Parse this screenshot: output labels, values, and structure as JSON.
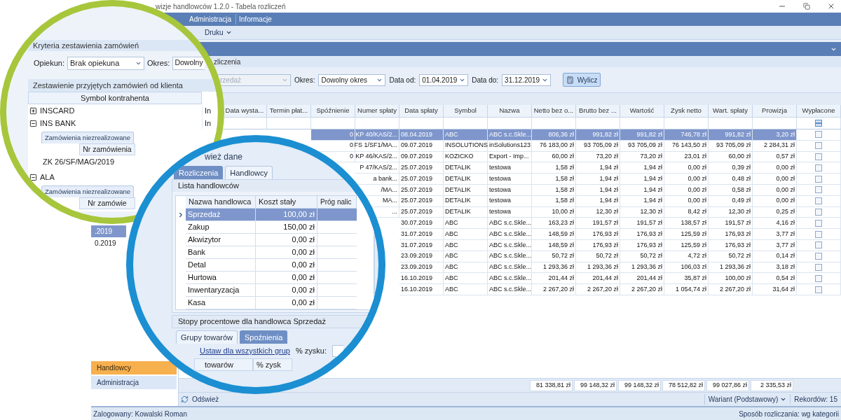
{
  "window": {
    "title": "wizje handlowców 1.2.0 - Tabela rozliczeń"
  },
  "menu": [
    {
      "label": "Administracja"
    },
    {
      "label": "Informacje"
    }
  ],
  "toolbar": {
    "print_menu": "Druku"
  },
  "settlement_panel": {
    "title": "zliczenia",
    "salesperson": {
      "value": "rzedaż",
      "disabled": true
    },
    "period_label": "Okres:",
    "period": "Dowolny okres",
    "date_from_label": "Data od:",
    "date_from": "01.04.2019",
    "date_to_label": "Data do:",
    "date_to": "31.12.2019",
    "calculate_button": "Wylicz"
  },
  "table": {
    "columns": [
      "Data wysta...",
      "Termin płat...",
      "Spóźnienie",
      "Numer spłaty",
      "Data spłaty",
      "Symbol",
      "Nazwa",
      "Netto bez o...",
      "Brutto bez ...",
      "Wartość",
      "Zysk netto",
      "Wart. spłaty",
      "Prowizja",
      "Wypłacone"
    ],
    "rows": [
      {
        "late": "0",
        "number": "KP 40/KAS/2...",
        "payment_date": "08.04.2019",
        "symbol": "ABC",
        "name": "ABC s.c.Skle...",
        "net": "806,36 zł",
        "gross": "991,82 zł",
        "value": "991,82 zł",
        "profit": "746,78 zł",
        "payment_value": "991,82 zł",
        "commission": "3,20 zł",
        "paid": false,
        "selected": true
      },
      {
        "late": "0",
        "number": "FS 1/SF1/MA...",
        "payment_date": "09.07.2019",
        "symbol": "INSOLUTIONS",
        "name": "inSolutions123",
        "net": "76 183,00 zł",
        "gross": "93 705,09 zł",
        "value": "93 705,09 zł",
        "profit": "76 143,50 zł",
        "payment_value": "93 705,09 zł",
        "commission": "2 284,31 zł",
        "paid": false,
        "selected": false
      },
      {
        "late": "0",
        "number": "KP 46/KAS/2...",
        "payment_date": "09.07.2019",
        "symbol": "KOZICKO",
        "name": "Export - Imp...",
        "net": "60,00 zł",
        "gross": "73,20 zł",
        "value": "73,20 zł",
        "profit": "23,01 zł",
        "payment_value": "60,00 zł",
        "commission": "0,57 zł",
        "paid": false,
        "selected": false
      },
      {
        "number": "P 47/KAS/2...",
        "payment_date": "25.07.2019",
        "symbol": "DETALIK",
        "name": "testowa",
        "net": "1,58 zł",
        "gross": "1,94 zł",
        "value": "1,94 zł",
        "profit": "0,00 zł",
        "payment_value": "0,39 zł",
        "commission": "0,00 zł",
        "paid": false,
        "selected": false
      },
      {
        "number": "a bank...",
        "payment_date": "25.07.2019",
        "symbol": "DETALIK",
        "name": "testowa",
        "net": "1,58 zł",
        "gross": "1,94 zł",
        "value": "1,94 zł",
        "profit": "0,00 zł",
        "payment_value": "0,48 zł",
        "commission": "0,00 zł",
        "paid": false,
        "selected": false
      },
      {
        "number": "/MA...",
        "payment_date": "25.07.2019",
        "symbol": "DETALIK",
        "name": "testowa",
        "net": "1,58 zł",
        "gross": "1,94 zł",
        "value": "1,94 zł",
        "profit": "0,00 zł",
        "payment_value": "0,58 zł",
        "commission": "0,00 zł",
        "paid": false,
        "selected": false
      },
      {
        "number": "MA...",
        "payment_date": "25.07.2019",
        "symbol": "DETALIK",
        "name": "testowa",
        "net": "1,58 zł",
        "gross": "1,94 zł",
        "value": "1,94 zł",
        "profit": "0,00 zł",
        "payment_value": "0,49 zł",
        "commission": "0,00 zł",
        "paid": false,
        "selected": false
      },
      {
        "number": "...",
        "payment_date": "25.07.2019",
        "symbol": "DETALIK",
        "name": "testowa",
        "net": "10,00 zł",
        "gross": "12,30 zł",
        "value": "12,30 zł",
        "profit": "8,42 zł",
        "payment_value": "12,30 zł",
        "commission": "0,25 zł",
        "paid": false,
        "selected": false
      },
      {
        "payment_date": "30.07.2019",
        "symbol": "ABC",
        "name": "ABC s.c.Skle...",
        "net": "163,23 zł",
        "gross": "191,57 zł",
        "value": "191,57 zł",
        "profit": "138,57 zł",
        "payment_value": "191,57 zł",
        "commission": "4,16 zł",
        "paid": false,
        "selected": false
      },
      {
        "payment_date": "31.07.2019",
        "symbol": "ABC",
        "name": "ABC s.c.Skle...",
        "net": "148,59 zł",
        "gross": "176,93 zł",
        "value": "176,93 zł",
        "profit": "125,59 zł",
        "payment_value": "176,93 zł",
        "commission": "3,77 zł",
        "paid": false,
        "selected": false
      },
      {
        "payment_date": "31.07.2019",
        "symbol": "ABC",
        "name": "ABC s.c.Skle...",
        "net": "148,59 zł",
        "gross": "176,93 zł",
        "value": "176,93 zł",
        "profit": "125,59 zł",
        "payment_value": "176,93 zł",
        "commission": "3,77 zł",
        "paid": false,
        "selected": false
      },
      {
        "payment_date": "23.09.2019",
        "symbol": "ABC",
        "name": "ABC s.c.Skle...",
        "net": "50,72 zł",
        "gross": "50,72 zł",
        "value": "50,72 zł",
        "profit": "4,72 zł",
        "payment_value": "50,72 zł",
        "commission": "0,14 zł",
        "paid": false,
        "selected": false
      },
      {
        "payment_date": "23.09.2019",
        "symbol": "ABC",
        "name": "ABC s.c.Skle...",
        "net": "1 293,36 zł",
        "gross": "1 293,36 zł",
        "value": "1 293,36 zł",
        "profit": "106,03 zł",
        "payment_value": "1 293,36 zł",
        "commission": "3,18 zł",
        "paid": false,
        "selected": false
      },
      {
        "payment_date": "16.10.2019",
        "symbol": "ABC",
        "name": "ABC s.c.Skle...",
        "net": "201,44 zł",
        "gross": "201,44 zł",
        "value": "201,44 zł",
        "profit": "35,87 zł",
        "payment_value": "100,00 zł",
        "commission": "0,54 zł",
        "paid": false,
        "selected": false
      },
      {
        "payment_date": "16.10.2019",
        "symbol": "ABC",
        "name": "ABC s.c.Skle...",
        "net": "2 267,20 zł",
        "gross": "2 267,20 zł",
        "value": "2 267,20 zł",
        "profit": "1 054,74 zł",
        "payment_value": "2 267,20 zł",
        "commission": "31,64 zł",
        "paid": false,
        "selected": false
      }
    ],
    "totals": [
      "81 338,81 zł",
      "99 148,32 zł",
      "99 148,32 zł",
      "78 512,82 zł",
      "99 027,86 zł",
      "2 335,53 zł"
    ]
  },
  "left_panel": {
    "dates": [
      {
        "text": ".2019",
        "selected": true
      },
      {
        "text": "0.2019",
        "selected": false
      }
    ],
    "nav": [
      {
        "label": "Handlowcy",
        "selected": true
      },
      {
        "label": "Administracja",
        "selected": false
      }
    ]
  },
  "bottom_bar": {
    "refresh_button": "Odśwież",
    "variant": "Wariant (Podstawowy)",
    "records": "Rekordów: 15"
  },
  "status_bar": {
    "user": "Zalogowany: Kowalski Roman",
    "mode": "Sposób rozliczania: wg kategorii"
  },
  "zoom_orders": {
    "title": "Kryteria zestawienia zamówień",
    "caretaker_label": "Opiekun:",
    "caretaker": "Brak opiekuna",
    "period_label": "Okres:",
    "period": "Dowolny",
    "section_title": "Zestawienie przyjętych zamówień od klienta",
    "column": "Symbol kontrahenta",
    "clients": [
      {
        "symbol": "INSCARD",
        "column_2": "In",
        "expanded": false
      },
      {
        "symbol": "INS BANK",
        "column_2": "In",
        "expanded": true,
        "detail": {
          "tab": "Zamówienia niezrealizowane",
          "column": "Nr zamówienia",
          "rows": [
            "ZK 26/SF/MAG/2019"
          ]
        }
      },
      {
        "symbol": "ALA",
        "expanded": true,
        "detail": {
          "tab": "Zamówienia niezrealizowane",
          "column": "Nr zamówie"
        }
      }
    ]
  },
  "zoom_salespeople": {
    "title": "wież dane",
    "tabs": [
      {
        "label": "Rozliczenia",
        "selected": false
      },
      {
        "label": "Handlowcy",
        "selected": true
      }
    ],
    "list_title": "Lista handlowców",
    "columns": [
      "Nazwa handlowca",
      "Koszt stały",
      "Próg nalic"
    ],
    "rows": [
      {
        "name": "Sprzedaż",
        "cost": "100,00 zł",
        "selected": true
      },
      {
        "name": "Zakup",
        "cost": "150,00 zł",
        "selected": false
      },
      {
        "name": "Akwizytor",
        "cost": "0,00 zł",
        "selected": false
      },
      {
        "name": "Bank",
        "cost": "0,00 zł",
        "selected": false
      },
      {
        "name": "Detal",
        "cost": "0,00 zł",
        "selected": false
      },
      {
        "name": "Hurtowa",
        "cost": "0,00 zł",
        "selected": false
      },
      {
        "name": "Inwentaryzacja",
        "cost": "0,00 zł",
        "selected": false
      },
      {
        "name": "Kasa",
        "cost": "0,00 zł",
        "selected": false
      }
    ],
    "rates_title": "Stopy procentowe dla handlowca Sprzedaż",
    "rate_tabs": [
      {
        "label": "Grupy towarów",
        "selected": true
      },
      {
        "label": "Spoźnienia",
        "selected": false
      }
    ],
    "set_all_link": "Ustaw dla wszystkich grup",
    "profit_label": "% zysku:",
    "groups_columns": [
      "towarów",
      "% zysk"
    ]
  }
}
